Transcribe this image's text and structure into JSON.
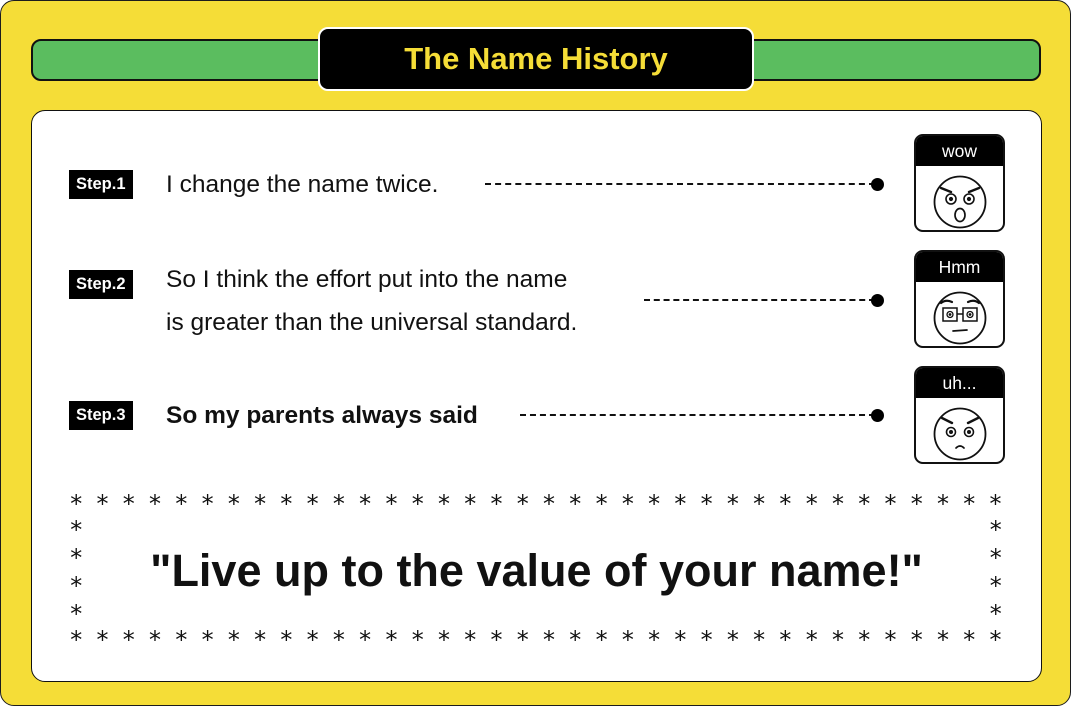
{
  "title": "The Name History",
  "steps": [
    {
      "badge": "Step.1",
      "lines": [
        "I change the name twice."
      ],
      "bold": false,
      "reaction": "wow",
      "face": "surprised-face-icon"
    },
    {
      "badge": "Step.2",
      "lines": [
        "So I think the effort put into the name",
        "is greater than the universal standard."
      ],
      "bold": false,
      "reaction": "Hmm",
      "face": "thinking-glasses-face-icon"
    },
    {
      "badge": "Step.3",
      "lines": [
        "So my parents always said"
      ],
      "bold": true,
      "reaction": "uh...",
      "face": "worried-face-icon"
    }
  ],
  "quote": "\"Live up to the value of your name!\"",
  "border_symbol": "*",
  "colors": {
    "background": "#f5dd37",
    "bar": "#5bbd5f",
    "title_text": "#f5dd37",
    "badge": "#000000",
    "panel": "#ffffff"
  }
}
